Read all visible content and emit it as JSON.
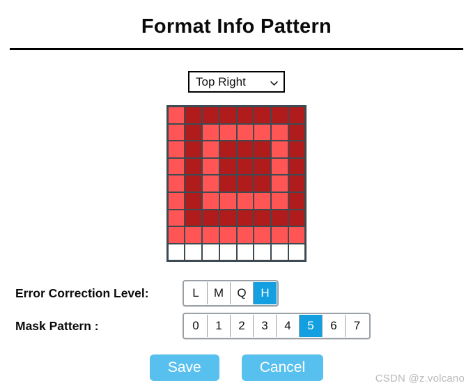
{
  "header": {
    "title": "Format Info Pattern"
  },
  "corner_select": {
    "name": "corner-position-select",
    "selected": "Top Right",
    "icon": "chevron-down-icon",
    "options": [
      "Top Right"
    ]
  },
  "grid": {
    "columns": 8,
    "rows": 9,
    "colors": {
      "light": "#ff5555",
      "dark": "#b01b1b",
      "blank": "#ffffff",
      "border": "#3e4a52"
    },
    "legend": {
      "light": "module-off",
      "dark": "module-on",
      "blank": "module-empty"
    },
    "matrix": [
      [
        "light",
        "dark",
        "dark",
        "dark",
        "dark",
        "dark",
        "dark",
        "dark"
      ],
      [
        "light",
        "dark",
        "light",
        "light",
        "light",
        "light",
        "light",
        "dark"
      ],
      [
        "light",
        "dark",
        "light",
        "dark",
        "dark",
        "dark",
        "light",
        "dark"
      ],
      [
        "light",
        "dark",
        "light",
        "dark",
        "dark",
        "dark",
        "light",
        "dark"
      ],
      [
        "light",
        "dark",
        "light",
        "dark",
        "dark",
        "dark",
        "light",
        "dark"
      ],
      [
        "light",
        "dark",
        "light",
        "light",
        "light",
        "light",
        "light",
        "dark"
      ],
      [
        "light",
        "dark",
        "dark",
        "dark",
        "dark",
        "dark",
        "dark",
        "dark"
      ],
      [
        "light",
        "light",
        "light",
        "light",
        "light",
        "light",
        "light",
        "light"
      ],
      [
        "blank",
        "blank",
        "blank",
        "blank",
        "blank",
        "blank",
        "blank",
        "blank"
      ]
    ]
  },
  "options": {
    "error_correction": {
      "label": "Error Correction Level:",
      "items": [
        "L",
        "M",
        "Q",
        "H"
      ],
      "selected": "H"
    },
    "mask_pattern": {
      "label": "Mask Pattern :",
      "items": [
        "0",
        "1",
        "2",
        "3",
        "4",
        "5",
        "6",
        "7"
      ],
      "selected": "5"
    },
    "selected_color": "#14a0e0"
  },
  "actions": {
    "save_label": "Save",
    "cancel_label": "Cancel",
    "button_color": "#58c0ee"
  },
  "watermark": {
    "text": "CSDN @z.volcano"
  }
}
